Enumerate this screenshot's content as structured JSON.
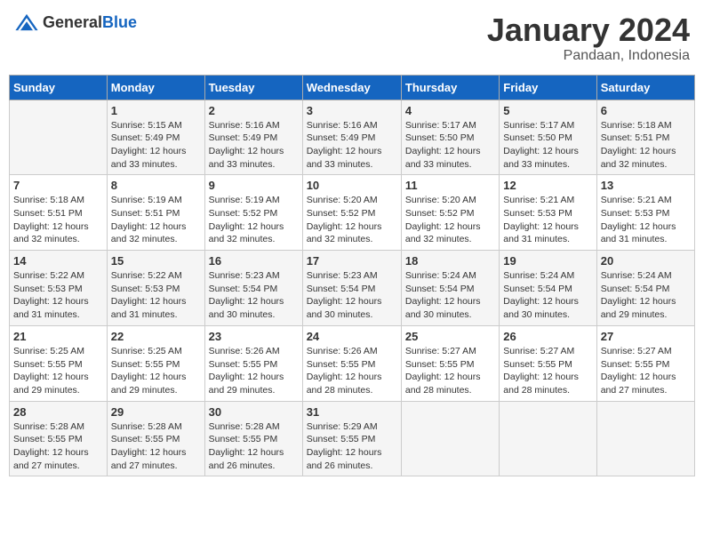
{
  "header": {
    "logo_general": "General",
    "logo_blue": "Blue",
    "month": "January 2024",
    "location": "Pandaan, Indonesia"
  },
  "days_of_week": [
    "Sunday",
    "Monday",
    "Tuesday",
    "Wednesday",
    "Thursday",
    "Friday",
    "Saturday"
  ],
  "weeks": [
    [
      {
        "day": "",
        "info": ""
      },
      {
        "day": "1",
        "info": "Sunrise: 5:15 AM\nSunset: 5:49 PM\nDaylight: 12 hours\nand 33 minutes."
      },
      {
        "day": "2",
        "info": "Sunrise: 5:16 AM\nSunset: 5:49 PM\nDaylight: 12 hours\nand 33 minutes."
      },
      {
        "day": "3",
        "info": "Sunrise: 5:16 AM\nSunset: 5:49 PM\nDaylight: 12 hours\nand 33 minutes."
      },
      {
        "day": "4",
        "info": "Sunrise: 5:17 AM\nSunset: 5:50 PM\nDaylight: 12 hours\nand 33 minutes."
      },
      {
        "day": "5",
        "info": "Sunrise: 5:17 AM\nSunset: 5:50 PM\nDaylight: 12 hours\nand 33 minutes."
      },
      {
        "day": "6",
        "info": "Sunrise: 5:18 AM\nSunset: 5:51 PM\nDaylight: 12 hours\nand 32 minutes."
      }
    ],
    [
      {
        "day": "7",
        "info": "Sunrise: 5:18 AM\nSunset: 5:51 PM\nDaylight: 12 hours\nand 32 minutes."
      },
      {
        "day": "8",
        "info": "Sunrise: 5:19 AM\nSunset: 5:51 PM\nDaylight: 12 hours\nand 32 minutes."
      },
      {
        "day": "9",
        "info": "Sunrise: 5:19 AM\nSunset: 5:52 PM\nDaylight: 12 hours\nand 32 minutes."
      },
      {
        "day": "10",
        "info": "Sunrise: 5:20 AM\nSunset: 5:52 PM\nDaylight: 12 hours\nand 32 minutes."
      },
      {
        "day": "11",
        "info": "Sunrise: 5:20 AM\nSunset: 5:52 PM\nDaylight: 12 hours\nand 32 minutes."
      },
      {
        "day": "12",
        "info": "Sunrise: 5:21 AM\nSunset: 5:53 PM\nDaylight: 12 hours\nand 31 minutes."
      },
      {
        "day": "13",
        "info": "Sunrise: 5:21 AM\nSunset: 5:53 PM\nDaylight: 12 hours\nand 31 minutes."
      }
    ],
    [
      {
        "day": "14",
        "info": "Sunrise: 5:22 AM\nSunset: 5:53 PM\nDaylight: 12 hours\nand 31 minutes."
      },
      {
        "day": "15",
        "info": "Sunrise: 5:22 AM\nSunset: 5:53 PM\nDaylight: 12 hours\nand 31 minutes."
      },
      {
        "day": "16",
        "info": "Sunrise: 5:23 AM\nSunset: 5:54 PM\nDaylight: 12 hours\nand 30 minutes."
      },
      {
        "day": "17",
        "info": "Sunrise: 5:23 AM\nSunset: 5:54 PM\nDaylight: 12 hours\nand 30 minutes."
      },
      {
        "day": "18",
        "info": "Sunrise: 5:24 AM\nSunset: 5:54 PM\nDaylight: 12 hours\nand 30 minutes."
      },
      {
        "day": "19",
        "info": "Sunrise: 5:24 AM\nSunset: 5:54 PM\nDaylight: 12 hours\nand 30 minutes."
      },
      {
        "day": "20",
        "info": "Sunrise: 5:24 AM\nSunset: 5:54 PM\nDaylight: 12 hours\nand 29 minutes."
      }
    ],
    [
      {
        "day": "21",
        "info": "Sunrise: 5:25 AM\nSunset: 5:55 PM\nDaylight: 12 hours\nand 29 minutes."
      },
      {
        "day": "22",
        "info": "Sunrise: 5:25 AM\nSunset: 5:55 PM\nDaylight: 12 hours\nand 29 minutes."
      },
      {
        "day": "23",
        "info": "Sunrise: 5:26 AM\nSunset: 5:55 PM\nDaylight: 12 hours\nand 29 minutes."
      },
      {
        "day": "24",
        "info": "Sunrise: 5:26 AM\nSunset: 5:55 PM\nDaylight: 12 hours\nand 28 minutes."
      },
      {
        "day": "25",
        "info": "Sunrise: 5:27 AM\nSunset: 5:55 PM\nDaylight: 12 hours\nand 28 minutes."
      },
      {
        "day": "26",
        "info": "Sunrise: 5:27 AM\nSunset: 5:55 PM\nDaylight: 12 hours\nand 28 minutes."
      },
      {
        "day": "27",
        "info": "Sunrise: 5:27 AM\nSunset: 5:55 PM\nDaylight: 12 hours\nand 27 minutes."
      }
    ],
    [
      {
        "day": "28",
        "info": "Sunrise: 5:28 AM\nSunset: 5:55 PM\nDaylight: 12 hours\nand 27 minutes."
      },
      {
        "day": "29",
        "info": "Sunrise: 5:28 AM\nSunset: 5:55 PM\nDaylight: 12 hours\nand 27 minutes."
      },
      {
        "day": "30",
        "info": "Sunrise: 5:28 AM\nSunset: 5:55 PM\nDaylight: 12 hours\nand 26 minutes."
      },
      {
        "day": "31",
        "info": "Sunrise: 5:29 AM\nSunset: 5:55 PM\nDaylight: 12 hours\nand 26 minutes."
      },
      {
        "day": "",
        "info": ""
      },
      {
        "day": "",
        "info": ""
      },
      {
        "day": "",
        "info": ""
      }
    ]
  ]
}
